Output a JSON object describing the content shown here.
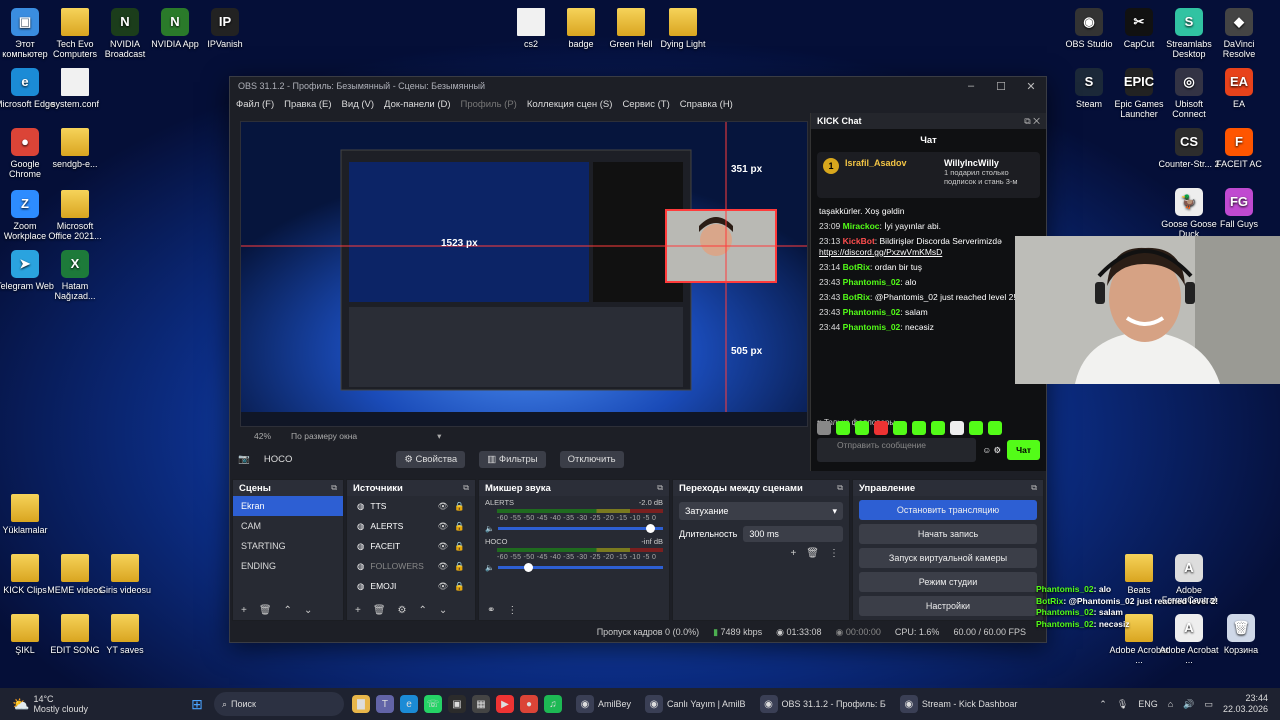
{
  "desktop_left": [
    {
      "label": "Этот компьютер",
      "name": "this-pc",
      "color": "#3a8de0",
      "glyph": "▣"
    },
    {
      "label": "Tech Evo Computers",
      "name": "tech-evo",
      "color": "",
      "glyph": ""
    },
    {
      "label": "NVIDIA Broadcast",
      "name": "nvidia-broadcast",
      "color": "#1b3d1b",
      "glyph": "N"
    },
    {
      "label": "NVIDIA App",
      "name": "nvidia-app",
      "color": "#2a7a2a",
      "glyph": "N"
    },
    {
      "label": "IPVanish",
      "name": "ipvanish",
      "color": "#222",
      "glyph": "IP"
    },
    {
      "label": "Microsoft Edge",
      "name": "edge",
      "color": "#1b8bd6",
      "glyph": "e"
    },
    {
      "label": "system.conf",
      "name": "system-conf",
      "color": "",
      "glyph": ""
    },
    {
      "label": "Google Chrome",
      "name": "chrome",
      "color": "#db4437",
      "glyph": "●"
    },
    {
      "label": "sendgb-e...",
      "name": "sendgb",
      "color": "",
      "glyph": ""
    },
    {
      "label": "Zoom Workplace",
      "name": "zoom",
      "color": "#2d8cff",
      "glyph": "Z"
    },
    {
      "label": "Microsoft Office 2021...",
      "name": "office",
      "color": "",
      "glyph": ""
    },
    {
      "label": "Telegram Web",
      "name": "telegram",
      "color": "#2aa3df",
      "glyph": "➤"
    },
    {
      "label": "Hatam Nağızad...",
      "name": "hatam",
      "color": "#1d7a3a",
      "glyph": "X"
    },
    {
      "label": "Yüklamalar",
      "name": "yuklamalar",
      "color": "",
      "glyph": ""
    },
    {
      "label": "KICK Clips",
      "name": "kick-clips",
      "color": "",
      "glyph": ""
    },
    {
      "label": "MEME videos",
      "name": "meme-videos",
      "color": "",
      "glyph": ""
    },
    {
      "label": "Giris videosu",
      "name": "giris-videosu",
      "color": "",
      "glyph": ""
    },
    {
      "label": "ŞIKL",
      "name": "sikl",
      "color": "",
      "glyph": ""
    },
    {
      "label": "EDIT SONG",
      "name": "edit-song",
      "color": "",
      "glyph": ""
    },
    {
      "label": "YT saves",
      "name": "yt-saves",
      "color": "",
      "glyph": ""
    }
  ],
  "desktop_top": [
    {
      "label": "cs2",
      "name": "cs2"
    },
    {
      "label": "badge",
      "name": "badge"
    },
    {
      "label": "Green Hell",
      "name": "green-hell"
    },
    {
      "label": "Dying Light",
      "name": "dying-light"
    }
  ],
  "desktop_right": [
    {
      "label": "OBS Studio",
      "name": "obs-studio",
      "color": "#333",
      "glyph": "◉"
    },
    {
      "label": "CapCut",
      "name": "capcut",
      "color": "#111",
      "glyph": "✂"
    },
    {
      "label": "Streamlabs Desktop",
      "name": "streamlabs",
      "color": "#31c3a2",
      "glyph": "S"
    },
    {
      "label": "DaVinci Resolve",
      "name": "davinci",
      "color": "#444",
      "glyph": "◆"
    },
    {
      "label": "Steam",
      "name": "steam",
      "color": "#1b2838",
      "glyph": "S"
    },
    {
      "label": "Epic Games Launcher",
      "name": "epic",
      "color": "#222",
      "glyph": "EPIC"
    },
    {
      "label": "Ubisoft Connect",
      "name": "ubisoft",
      "color": "#334",
      "glyph": "◎"
    },
    {
      "label": "EA",
      "name": "ea",
      "color": "#e8421b",
      "glyph": "EA"
    },
    {
      "label": "Counter-Str... 2",
      "name": "cs2-game",
      "color": "#2d2d2d",
      "glyph": "CS"
    },
    {
      "label": "FACEIT AC",
      "name": "faceit",
      "color": "#ff5500",
      "glyph": "F"
    },
    {
      "label": "Goose Goose Duck",
      "name": "ggd",
      "color": "#eee",
      "glyph": "🦆"
    },
    {
      "label": "Fall Guys",
      "name": "fall-guys",
      "color": "#c04ad0",
      "glyph": "FG"
    },
    {
      "label": "Beats",
      "name": "beats",
      "color": "",
      "glyph": ""
    },
    {
      "label": "Adobe FormsCentral",
      "name": "formscentral",
      "color": "#ddd",
      "glyph": "A"
    },
    {
      "label": "Adobe Acrobat ...",
      "name": "acrobat1",
      "color": "",
      "glyph": ""
    },
    {
      "label": "Adobe Acrobat ...",
      "name": "acrobat2",
      "color": "#eee",
      "glyph": "A"
    },
    {
      "label": "Корзина",
      "name": "recycle-bin",
      "color": "#cfd8e8",
      "glyph": "🗑"
    }
  ],
  "obs": {
    "title": "OBS 31.1.2 - Профиль: Безымянный - Сцены: Безымянный",
    "menu": [
      "Файл (F)",
      "Правка (E)",
      "Вид (V)",
      "Док-панели (D)",
      "Профиль (P)",
      "Коллекция сцен (S)",
      "Сервис (T)",
      "Справка (H)"
    ],
    "zoom": "42%",
    "fit": "По размеру окна",
    "source_name": "HOCO",
    "props": "Свойства",
    "filters": "Фильтры",
    "disable": "Отключить",
    "preview_labels": {
      "w1": "1523 px",
      "w2": "351 px",
      "w3": "505 px"
    },
    "scenes_title": "Сцены",
    "scenes": [
      "Ekran",
      "CAM",
      "STARTING",
      "ENDING"
    ],
    "sources_title": "Источники",
    "sources": [
      "TTS",
      "ALERTS",
      "FACEIT",
      "FOLLOWERS",
      "EMOJI"
    ],
    "mixer_title": "Микшер звука",
    "mixer": [
      {
        "name": "ALERTS",
        "db": "-2.0 dB"
      },
      {
        "name": "HOCO",
        "db": "-inf dB"
      }
    ],
    "scale": "-60 -55 -50 -45 -40 -35 -30 -25 -20 -15 -10 -5 0",
    "transitions_title": "Переходы между сценами",
    "transition": "Затухание",
    "duration_label": "Длительность",
    "duration": "300 ms",
    "controls_title": "Управление",
    "controls": [
      "Остановить трансляцию",
      "Начать запись",
      "Запуск виртуальной камеры",
      "Режим студии",
      "Настройки"
    ],
    "status": {
      "frames": "Пропуск кадров 0 (0.0%)",
      "bitrate": "7489 kbps",
      "live": "01:33:08",
      "rec": "00:00:00",
      "cpu": "CPU: 1.6%",
      "fps": "60.00 / 60.00 FPS"
    }
  },
  "chat": {
    "title": "KICK Chat",
    "tab": "Чат",
    "pinned_user": "Israfil_Asadov",
    "pinned_count": "1",
    "pinned_right_user": "WillyIncWilly",
    "pinned_right_text": "1 подарил столько подписок и стань 3-м",
    "messages": [
      {
        "time": "",
        "name": "",
        "text": "taşakkürler. Xoş gəldin"
      },
      {
        "time": "23:09",
        "name": "Mirackoc",
        "text": "İyi yayınlar abi."
      },
      {
        "time": "23:13",
        "name": "KickBot",
        "text": "Bildirişlər Discorda Serverimizdə",
        "link": "https://discord.gg/PxzwVmKMsD"
      },
      {
        "time": "23:14",
        "name": "BotRix",
        "text": "ordan bir tuş"
      },
      {
        "time": "23:43",
        "name": "Phantomis_02",
        "text": "alo"
      },
      {
        "time": "23:43",
        "name": "BotRix",
        "text": "@Phantomis_02 just reached level 2!"
      },
      {
        "time": "23:43",
        "name": "Phantomis_02",
        "text": "salam"
      },
      {
        "time": "23:44",
        "name": "Phantomis_02",
        "text": "necəsiz"
      }
    ],
    "followers_only": "Только фолловеры",
    "input_placeholder": "Отправить сообщение",
    "send": "Чат"
  },
  "overlay_chat": [
    {
      "name": "Phantomis_02",
      "text": "alo"
    },
    {
      "name": "BotRix",
      "text": "@Phantomis_02 just reached level 2!"
    },
    {
      "name": "Phantomis_02",
      "text": "salam"
    },
    {
      "name": "Phantomis_02",
      "text": "necəsiz"
    }
  ],
  "taskbar": {
    "weather_temp": "14°C",
    "weather_desc": "Mostly cloudy",
    "search": "Поиск",
    "apps": [
      {
        "label": "AmilBey",
        "name": "amilbey-app"
      },
      {
        "label": "Canlı Yayım | AmilB",
        "name": "canli-yayim-app"
      },
      {
        "label": "OBS 31.1.2 - Профиль: Б",
        "name": "obs-task-app"
      },
      {
        "label": "Stream - Kick Dashboar",
        "name": "kick-dashboard-app"
      }
    ],
    "lang": "ENG",
    "time": "23:44",
    "date": "22.03.2026"
  }
}
